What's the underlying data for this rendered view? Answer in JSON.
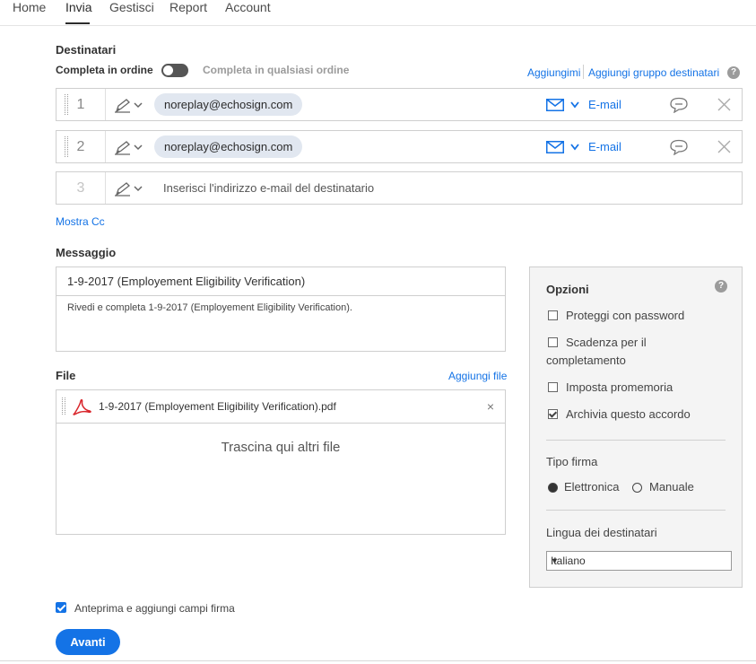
{
  "nav": {
    "items": [
      {
        "label": "Home"
      },
      {
        "label": "Invia"
      },
      {
        "label": "Gestisci"
      },
      {
        "label": "Report"
      },
      {
        "label": "Account"
      }
    ],
    "active": "Invia"
  },
  "recipients": {
    "section_label": "Destinatari",
    "order_label": "Completa in ordine",
    "any_order_label": "Completa in qualsiasi ordine",
    "add_me": "Aggiungimi",
    "add_group": "Aggiungi gruppo destinatari",
    "help_icon": "?",
    "rows": [
      {
        "number": "1",
        "email": "noreplay@echosign.com",
        "method": "E-mail"
      },
      {
        "number": "2",
        "email": "noreplay@echosign.com",
        "method": "E-mail"
      },
      {
        "number": "3",
        "placeholder": "Inserisci l'indirizzo e-mail del destinatario"
      }
    ],
    "show_cc": "Mostra Cc"
  },
  "message": {
    "section_label": "Messaggio",
    "title": "1-9-2017 (Employement Eligibility Verification)",
    "body": "Rivedi e completa 1-9-2017 (Employement Eligibility Verification)."
  },
  "files": {
    "section_label": "File",
    "add_file": "Aggiungi file",
    "items": [
      {
        "name": "1-9-2017 (Employement Eligibility Verification).pdf",
        "remove": "×"
      }
    ],
    "dropzone": "Trascina qui altri file"
  },
  "options": {
    "title": "Opzioni",
    "help_icon": "?",
    "checks": [
      {
        "label": "Proteggi con password",
        "checked": false
      },
      {
        "label": "Scadenza per il",
        "label2": "completamento",
        "checked": false
      },
      {
        "label": "Imposta promemoria",
        "checked": false
      },
      {
        "label": "Archivia questo accordo",
        "checked": true
      }
    ],
    "signature_type_label": "Tipo firma",
    "signature_types": [
      {
        "label": "Elettronica",
        "selected": true
      },
      {
        "label": "Manuale",
        "selected": false
      }
    ],
    "language_label": "Lingua dei destinatari",
    "language_value": "Italiano",
    "caret": "▼"
  },
  "preview_checkbox": {
    "label": "Anteprima e aggiungi campi firma",
    "checked": true
  },
  "next_button": "Avanti",
  "colors": {
    "accent": "#1473e6",
    "chip": "#e1e7f0",
    "pdf_red": "#d9262c"
  }
}
